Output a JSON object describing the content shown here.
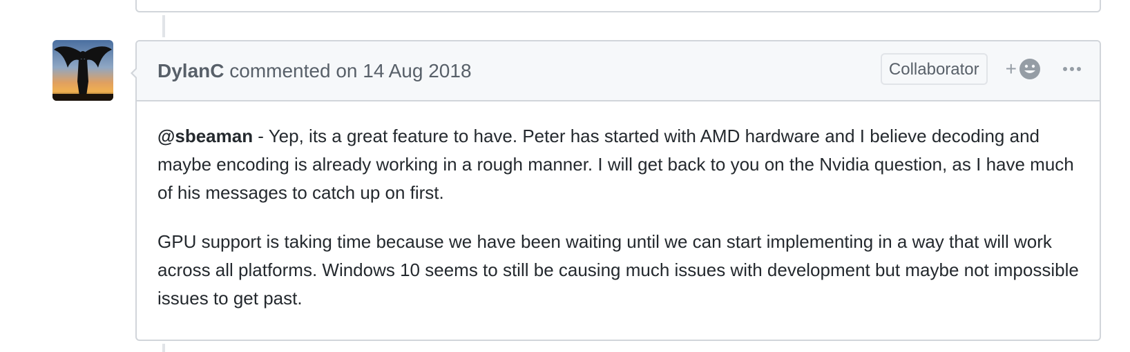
{
  "comment": {
    "author": "DylanC",
    "action_text": "commented on 14 Aug 2018",
    "role_badge": "Collaborator",
    "reaction_plus": "+",
    "body": {
      "mention": "@sbeaman",
      "paragraph1_rest": " - Yep, its a great feature to have. Peter has started with AMD hardware and I believe decoding and maybe encoding is already working in a rough manner. I will get back to you on the Nvidia question, as I have much of his messages to catch up on first.",
      "paragraph2": "GPU support is taking time because we have been waiting until we can start implementing in a way that will work across all platforms. Windows 10 seems to still be causing much issues with development but maybe not impossible issues to get past."
    }
  },
  "icons": {
    "reaction": "smiley-icon",
    "more": "kebab-horizontal-icon"
  },
  "colors": {
    "border": "#d1d5da",
    "header_bg": "#f6f8fa",
    "muted_text": "#586069",
    "body_text": "#24292e"
  }
}
